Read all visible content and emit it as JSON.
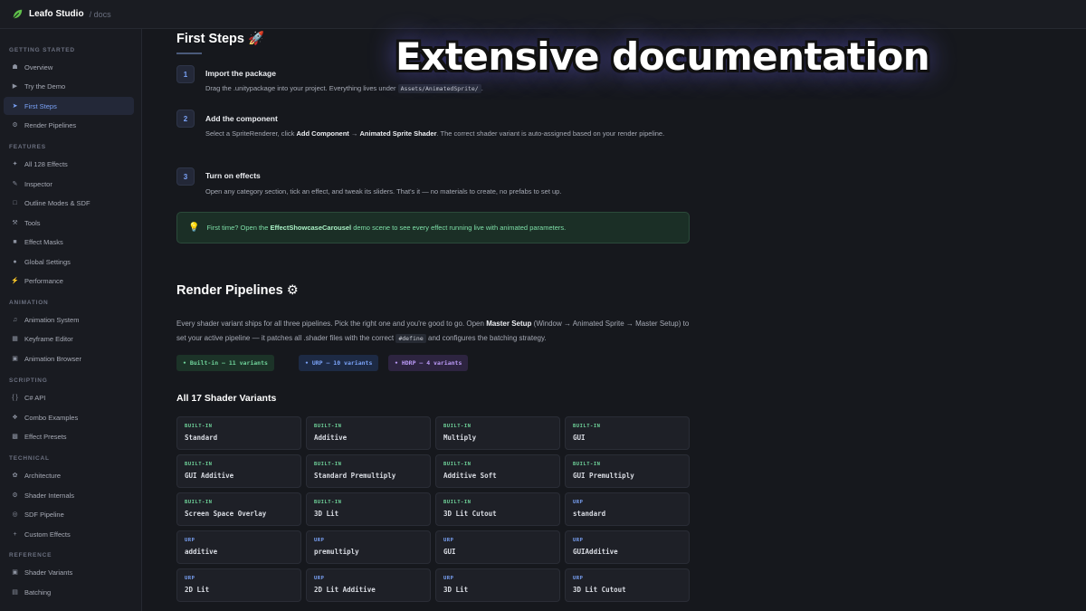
{
  "topbar": {
    "brand": "Leafo Studio",
    "crumb": "/ docs"
  },
  "sidebar": {
    "sections": [
      {
        "title": "GETTING STARTED",
        "items": [
          {
            "label": "Overview",
            "icon": "home-icon"
          },
          {
            "label": "Try the Demo",
            "icon": "play-icon"
          },
          {
            "label": "First Steps",
            "icon": "rocket-icon",
            "active": true
          },
          {
            "label": "Render Pipelines",
            "icon": "gear-icon"
          }
        ]
      },
      {
        "title": "FEATURES",
        "items": [
          {
            "label": "All 128 Effects",
            "icon": "sparkle-icon"
          },
          {
            "label": "Inspector",
            "icon": "pencil-icon"
          },
          {
            "label": "Outline Modes & SDF",
            "icon": "square-icon"
          },
          {
            "label": "Tools",
            "icon": "tools-icon"
          },
          {
            "label": "Effect Masks",
            "icon": "mask-icon"
          },
          {
            "label": "Global Settings",
            "icon": "globe-icon"
          },
          {
            "label": "Performance",
            "icon": "bolt-icon"
          }
        ]
      },
      {
        "title": "ANIMATION",
        "items": [
          {
            "label": "Animation System",
            "icon": "music-icon"
          },
          {
            "label": "Keyframe Editor",
            "icon": "keyframe-icon"
          },
          {
            "label": "Animation Browser",
            "icon": "folder-icon"
          }
        ]
      },
      {
        "title": "SCRIPTING",
        "items": [
          {
            "label": "C# API",
            "icon": "braces-icon"
          },
          {
            "label": "Combo Examples",
            "icon": "puzzle-icon"
          },
          {
            "label": "Effect Presets",
            "icon": "box-icon"
          }
        ]
      },
      {
        "title": "TECHNICAL",
        "items": [
          {
            "label": "Architecture",
            "icon": "brain-icon"
          },
          {
            "label": "Shader Internals",
            "icon": "cog-icon"
          },
          {
            "label": "SDF Pipeline",
            "icon": "target-icon"
          },
          {
            "label": "Custom Effects",
            "icon": "plus-icon"
          }
        ]
      },
      {
        "title": "REFERENCE",
        "items": [
          {
            "label": "Shader Variants",
            "icon": "layers-icon"
          },
          {
            "label": "Batching",
            "icon": "stack-icon"
          }
        ]
      }
    ]
  },
  "first_steps": {
    "title": "First Steps",
    "emoji": "🚀",
    "steps": [
      {
        "num": "1",
        "title": "Import the package",
        "body_pre": "Drag the .unitypackage into your project. Everything lives under",
        "code": "Assets/AnimatedSprite/",
        "body_post": "."
      },
      {
        "num": "2",
        "title": "Add the component",
        "body_pre": "Select a SpriteRenderer, click",
        "b1": "Add Component",
        "arrow": " → ",
        "b2": "Animated Sprite Shader",
        "body_post": ". The correct shader variant is auto-assigned based on your render pipeline."
      },
      {
        "num": "3",
        "title": "Turn on effects",
        "body": "Open any category section, tick an effect, and tweak its sliders. That's it — no materials to create, no prefabs to set up."
      }
    ],
    "tip": {
      "pre": "First time? Open the",
      "bold": "EffectShowcaseCarousel",
      "post": "demo scene to see every effect running live with animated parameters."
    }
  },
  "render_pipelines": {
    "title": "Render Pipelines",
    "emoji": "⚙",
    "p_pre": "Every shader variant ships for all three pipelines. Pick the right one and you're good to go. Open",
    "p_b": "Master Setup",
    "p_mid": "(Window → Animated Sprite → Master Setup) to set your active pipeline — it patches all .shader files with the correct",
    "p_code": "#define",
    "p_post": "and configures the batching strategy.",
    "pills": [
      {
        "label": "• Built-in — 11 variants",
        "color": "#6fd39a",
        "bg": "#1c3328"
      },
      {
        "label": "• URP — 10 variants",
        "color": "#7aa2f7",
        "bg": "#1d2a44"
      },
      {
        "label": "• HDRP — 4 variants",
        "color": "#bb9af7",
        "bg": "#2d2440"
      }
    ]
  },
  "variants": {
    "title": "All 17 Shader Variants",
    "colors": {
      "BUILT-IN": "#6fd39a",
      "URP": "#7aa2f7"
    },
    "cards": [
      {
        "tag": "BUILT-IN",
        "name": "Standard"
      },
      {
        "tag": "BUILT-IN",
        "name": "Additive"
      },
      {
        "tag": "BUILT-IN",
        "name": "Multiply"
      },
      {
        "tag": "BUILT-IN",
        "name": "GUI"
      },
      {
        "tag": "BUILT-IN",
        "name": "GUI Additive"
      },
      {
        "tag": "BUILT-IN",
        "name": "Standard Premultiply"
      },
      {
        "tag": "BUILT-IN",
        "name": "Additive Soft"
      },
      {
        "tag": "BUILT-IN",
        "name": "GUI Premultiply"
      },
      {
        "tag": "BUILT-IN",
        "name": "Screen Space Overlay"
      },
      {
        "tag": "BUILT-IN",
        "name": "3D Lit"
      },
      {
        "tag": "BUILT-IN",
        "name": "3D Lit Cutout"
      },
      {
        "tag": "URP",
        "name": "standard"
      },
      {
        "tag": "URP",
        "name": "additive"
      },
      {
        "tag": "URP",
        "name": "premultiply"
      },
      {
        "tag": "URP",
        "name": "GUI"
      },
      {
        "tag": "URP",
        "name": "GUIAdditive"
      },
      {
        "tag": "URP",
        "name": "2D Lit"
      },
      {
        "tag": "URP",
        "name": "2D Lit Additive"
      },
      {
        "tag": "URP",
        "name": "3D Lit"
      },
      {
        "tag": "URP",
        "name": "3D Lit Cutout"
      }
    ]
  },
  "overlay": {
    "banner": "Extensive documentation"
  }
}
